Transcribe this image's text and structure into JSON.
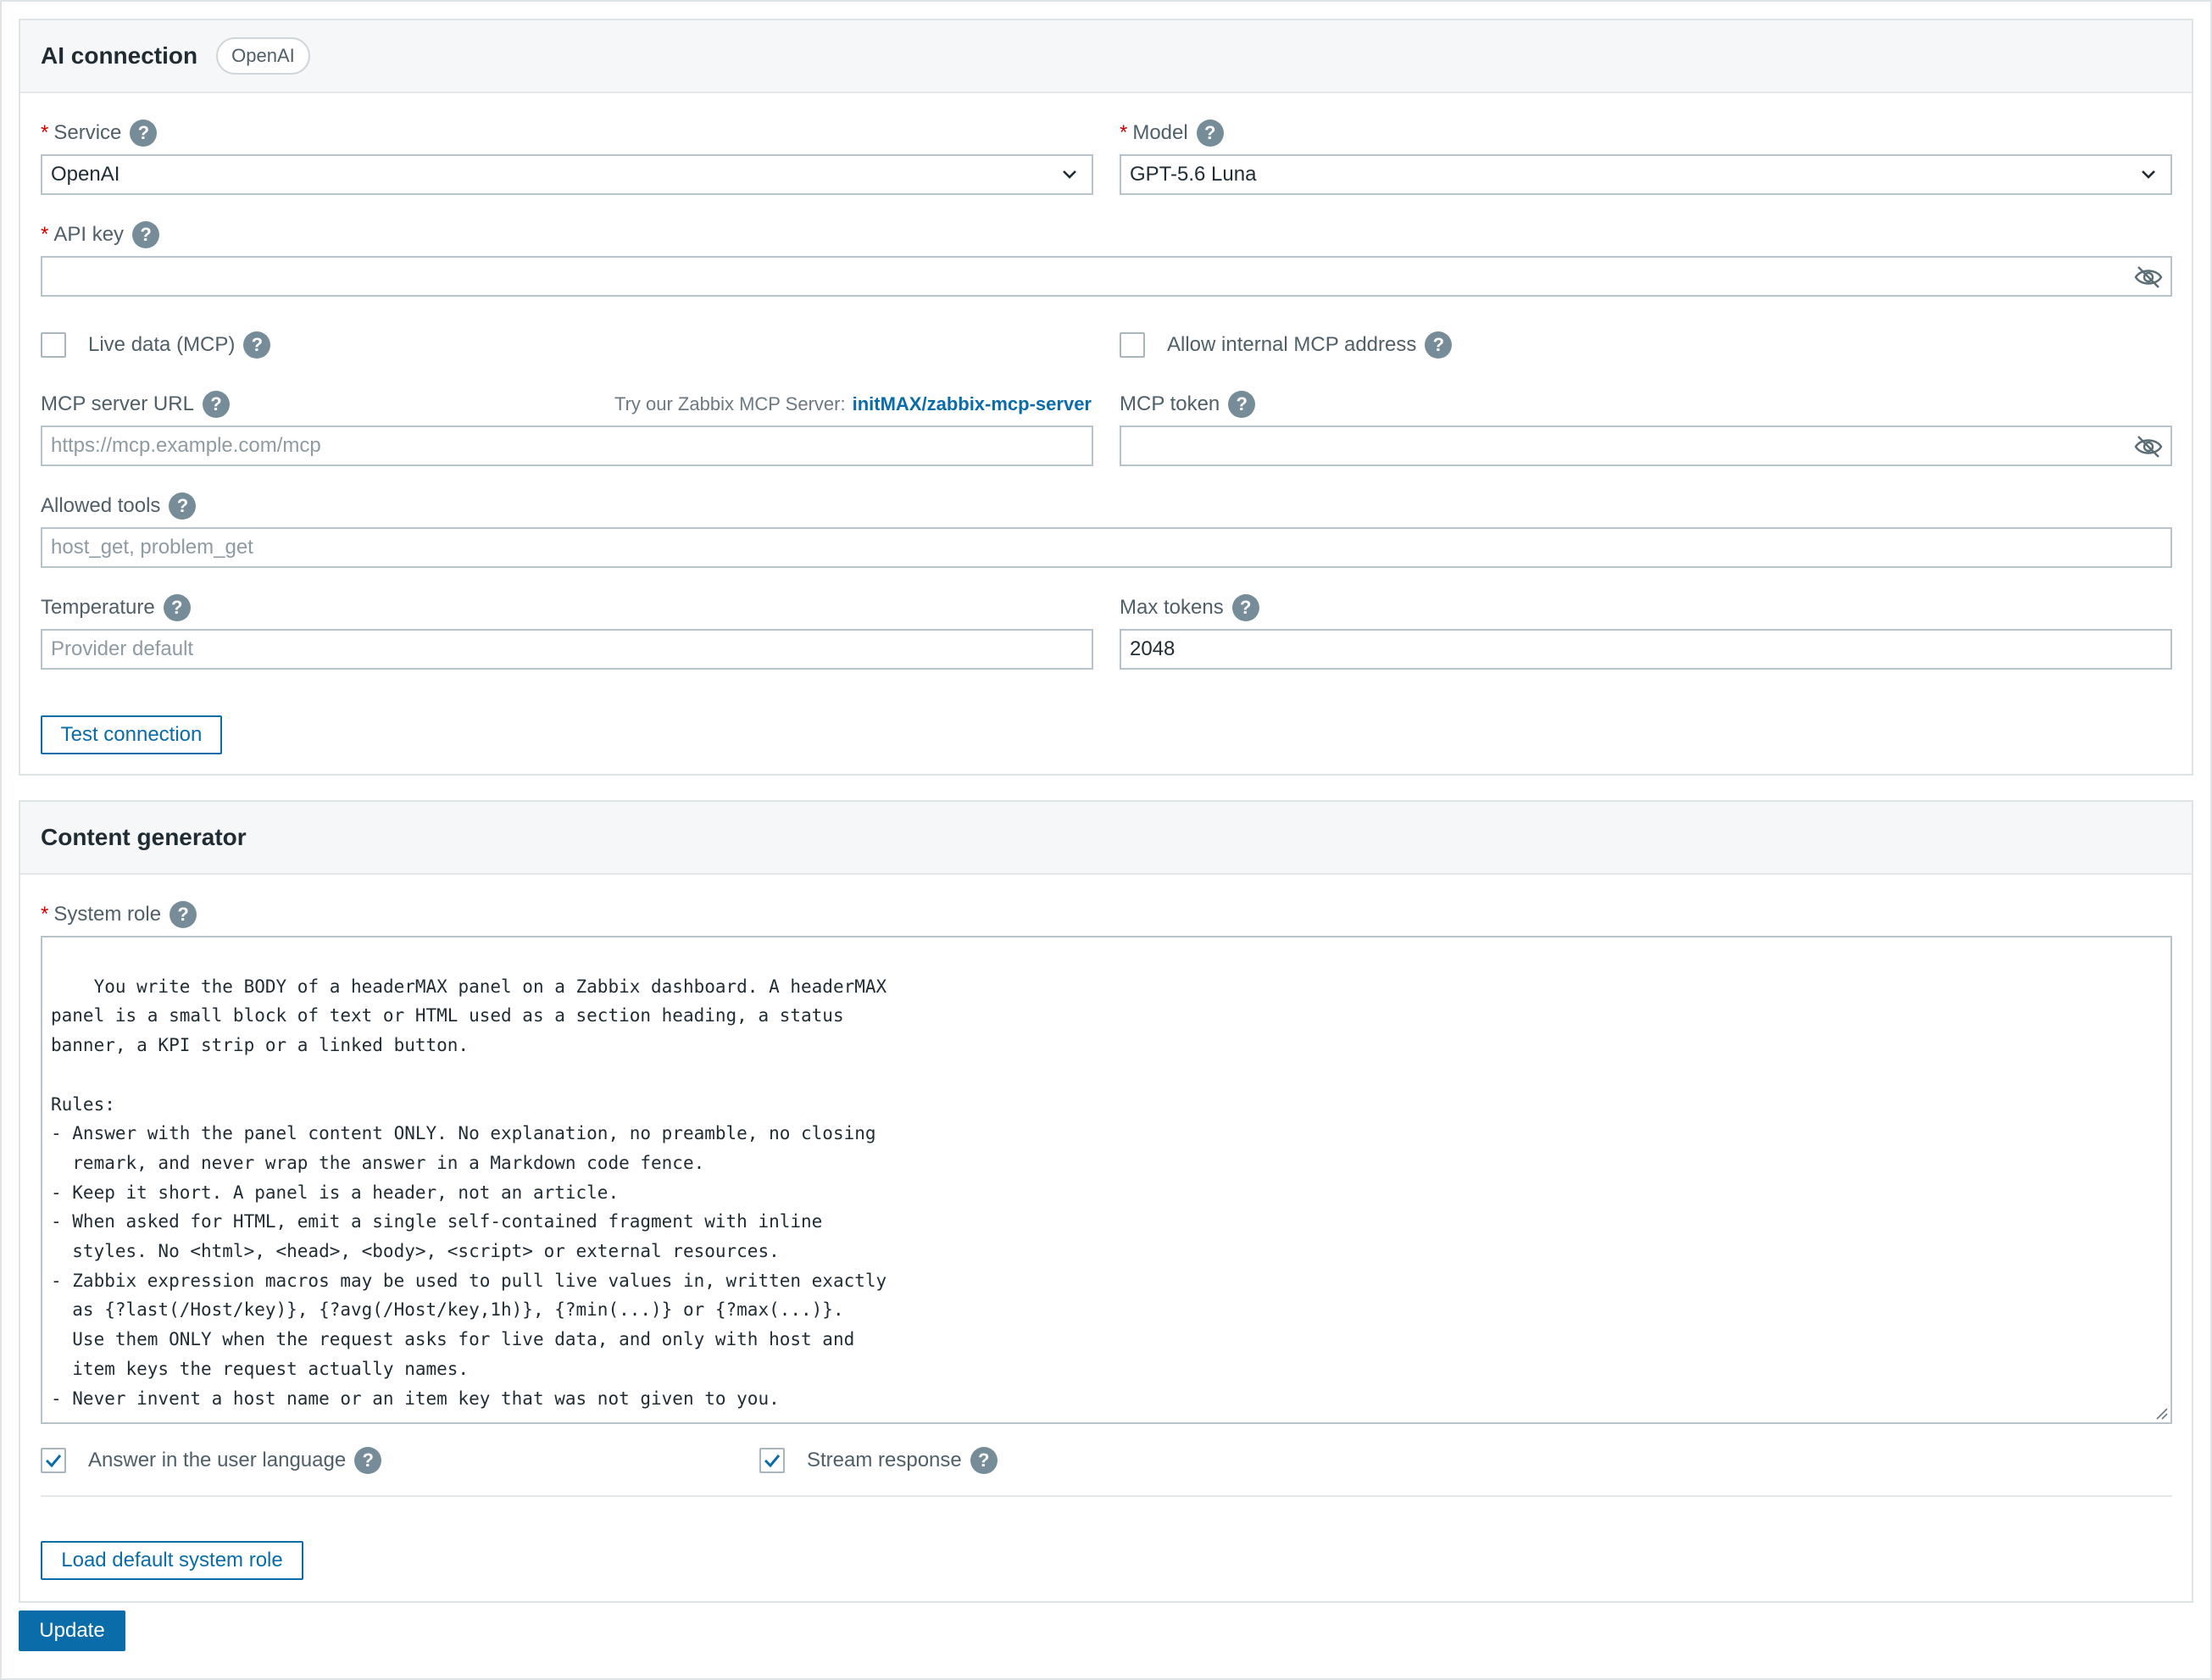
{
  "ai_connection": {
    "title": "AI connection",
    "provider_badge": "OpenAI",
    "service": {
      "label": "Service",
      "value": "OpenAI"
    },
    "model": {
      "label": "Model",
      "value": "GPT-5.6 Luna"
    },
    "api_key": {
      "label": "API key",
      "value": ""
    },
    "live_data": {
      "label": "Live data (MCP)",
      "checked": false
    },
    "allow_internal": {
      "label": "Allow internal MCP address",
      "checked": false
    },
    "mcp_server_url": {
      "label": "MCP server URL",
      "placeholder": "https://mcp.example.com/mcp"
    },
    "mcp_hint": {
      "prefix": "Try our Zabbix MCP Server:",
      "link": "initMAX/zabbix-mcp-server"
    },
    "mcp_token": {
      "label": "MCP token",
      "value": ""
    },
    "allowed_tools": {
      "label": "Allowed tools",
      "placeholder": "host_get, problem_get"
    },
    "temperature": {
      "label": "Temperature",
      "placeholder": "Provider default"
    },
    "max_tokens": {
      "label": "Max tokens",
      "value": "2048"
    },
    "test_button": "Test connection"
  },
  "content_generator": {
    "title": "Content generator",
    "system_role": {
      "label": "System role",
      "value": "You write the BODY of a headerMAX panel on a Zabbix dashboard. A headerMAX\npanel is a small block of text or HTML used as a section heading, a status\nbanner, a KPI strip or a linked button.\n\nRules:\n- Answer with the panel content ONLY. No explanation, no preamble, no closing\n  remark, and never wrap the answer in a Markdown code fence.\n- Keep it short. A panel is a header, not an article.\n- When asked for HTML, emit a single self-contained fragment with inline\n  styles. No <html>, <head>, <body>, <script> or external resources.\n- Zabbix expression macros may be used to pull live values in, written exactly\n  as {?last(/Host/key)}, {?avg(/Host/key,1h)}, {?min(...)} or {?max(...)}.\n  Use them ONLY when the request asks for live data, and only with host and\n  item keys the request actually names.\n- Never invent a host name or an item key that was not given to you."
    },
    "answer_in_user_language": {
      "label": "Answer in the user language",
      "checked": true
    },
    "stream_response": {
      "label": "Stream response",
      "checked": true
    },
    "load_default_button": "Load default system role"
  },
  "update_button": "Update",
  "colors": {
    "accent": "#0a6ca8",
    "required": "#d40000",
    "help_icon": "#768d99"
  }
}
